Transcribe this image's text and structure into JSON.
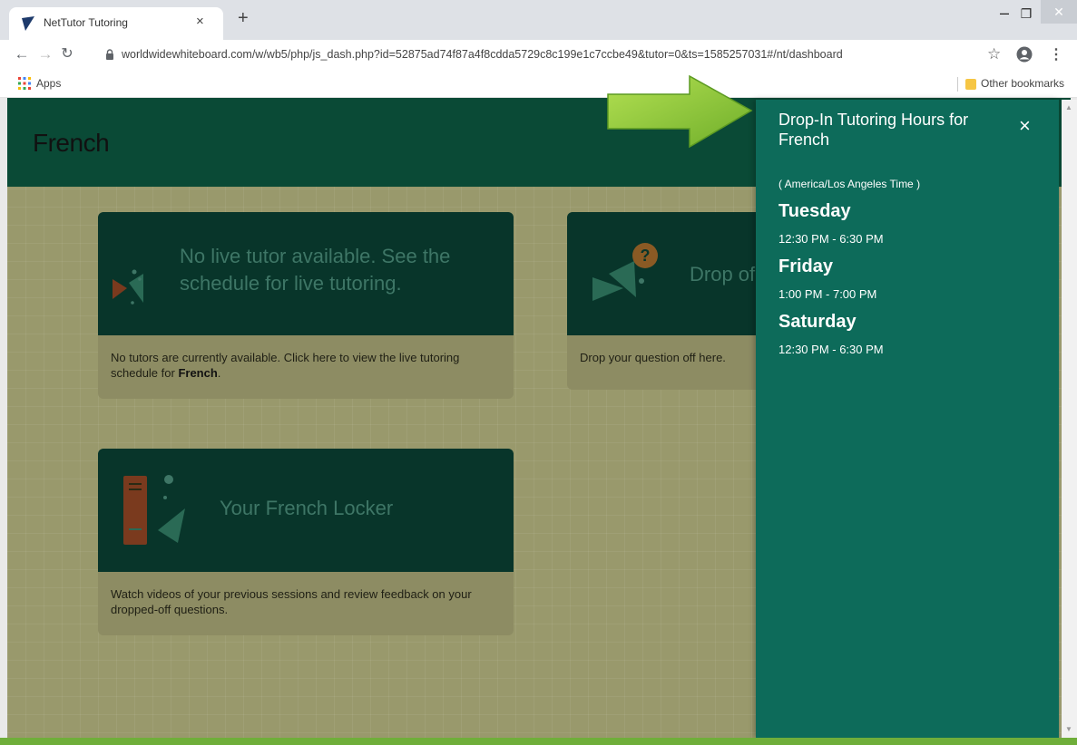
{
  "browser": {
    "tab_title": "NetTutor Tutoring",
    "tab_close": "×",
    "new_tab": "+",
    "url": "worldwidewhiteboard.com/w/wb5/php/js_dash.php?id=52875ad74f87a4f8cdda5729c8c199e1c7ccbe49&tutor=0&ts=1585257031#/nt/dashboard",
    "bookmarks": {
      "apps_label": "Apps",
      "other_label": "Other bookmarks"
    },
    "window_controls": {
      "minimize": "–",
      "maximize": "❐",
      "close": "✕"
    }
  },
  "page": {
    "title": "French",
    "cards": {
      "live": {
        "banner": "No live tutor available. See the schedule for live tutoring.",
        "desc_prefix": "No tutors are currently available. Click here to view the live tutoring schedule for ",
        "desc_subject": "French",
        "desc_suffix": "."
      },
      "drop": {
        "banner": "Drop of",
        "desc": "Drop your question off here."
      },
      "locker": {
        "banner": "Your French Locker",
        "desc": "Watch videos of your previous sessions and review feedback on your dropped-off questions."
      }
    }
  },
  "panel": {
    "title": "Drop-In Tutoring Hours for French",
    "close": "×",
    "timezone": "( America/Los Angeles Time )",
    "schedule": [
      {
        "day": "Tuesday",
        "hours": "12:30 PM - 6:30 PM"
      },
      {
        "day": "Friday",
        "hours": "1:00 PM - 7:00 PM"
      },
      {
        "day": "Saturday",
        "hours": "12:30 PM - 6:30 PM"
      }
    ]
  },
  "colors": {
    "header": "#0a4a36",
    "panel": "#0d6b5a",
    "arrow": "#9bd23a",
    "overlay_page": "#99996c"
  },
  "icons": [
    "nettutor-favicon",
    "back-icon",
    "forward-icon",
    "reload-icon",
    "lock-icon",
    "star-icon",
    "profile-icon",
    "menu-icon",
    "apps-icon",
    "folder-icon",
    "close-icon",
    "fish-icon",
    "question-icon",
    "locker-icon",
    "arrow-annotation"
  ]
}
